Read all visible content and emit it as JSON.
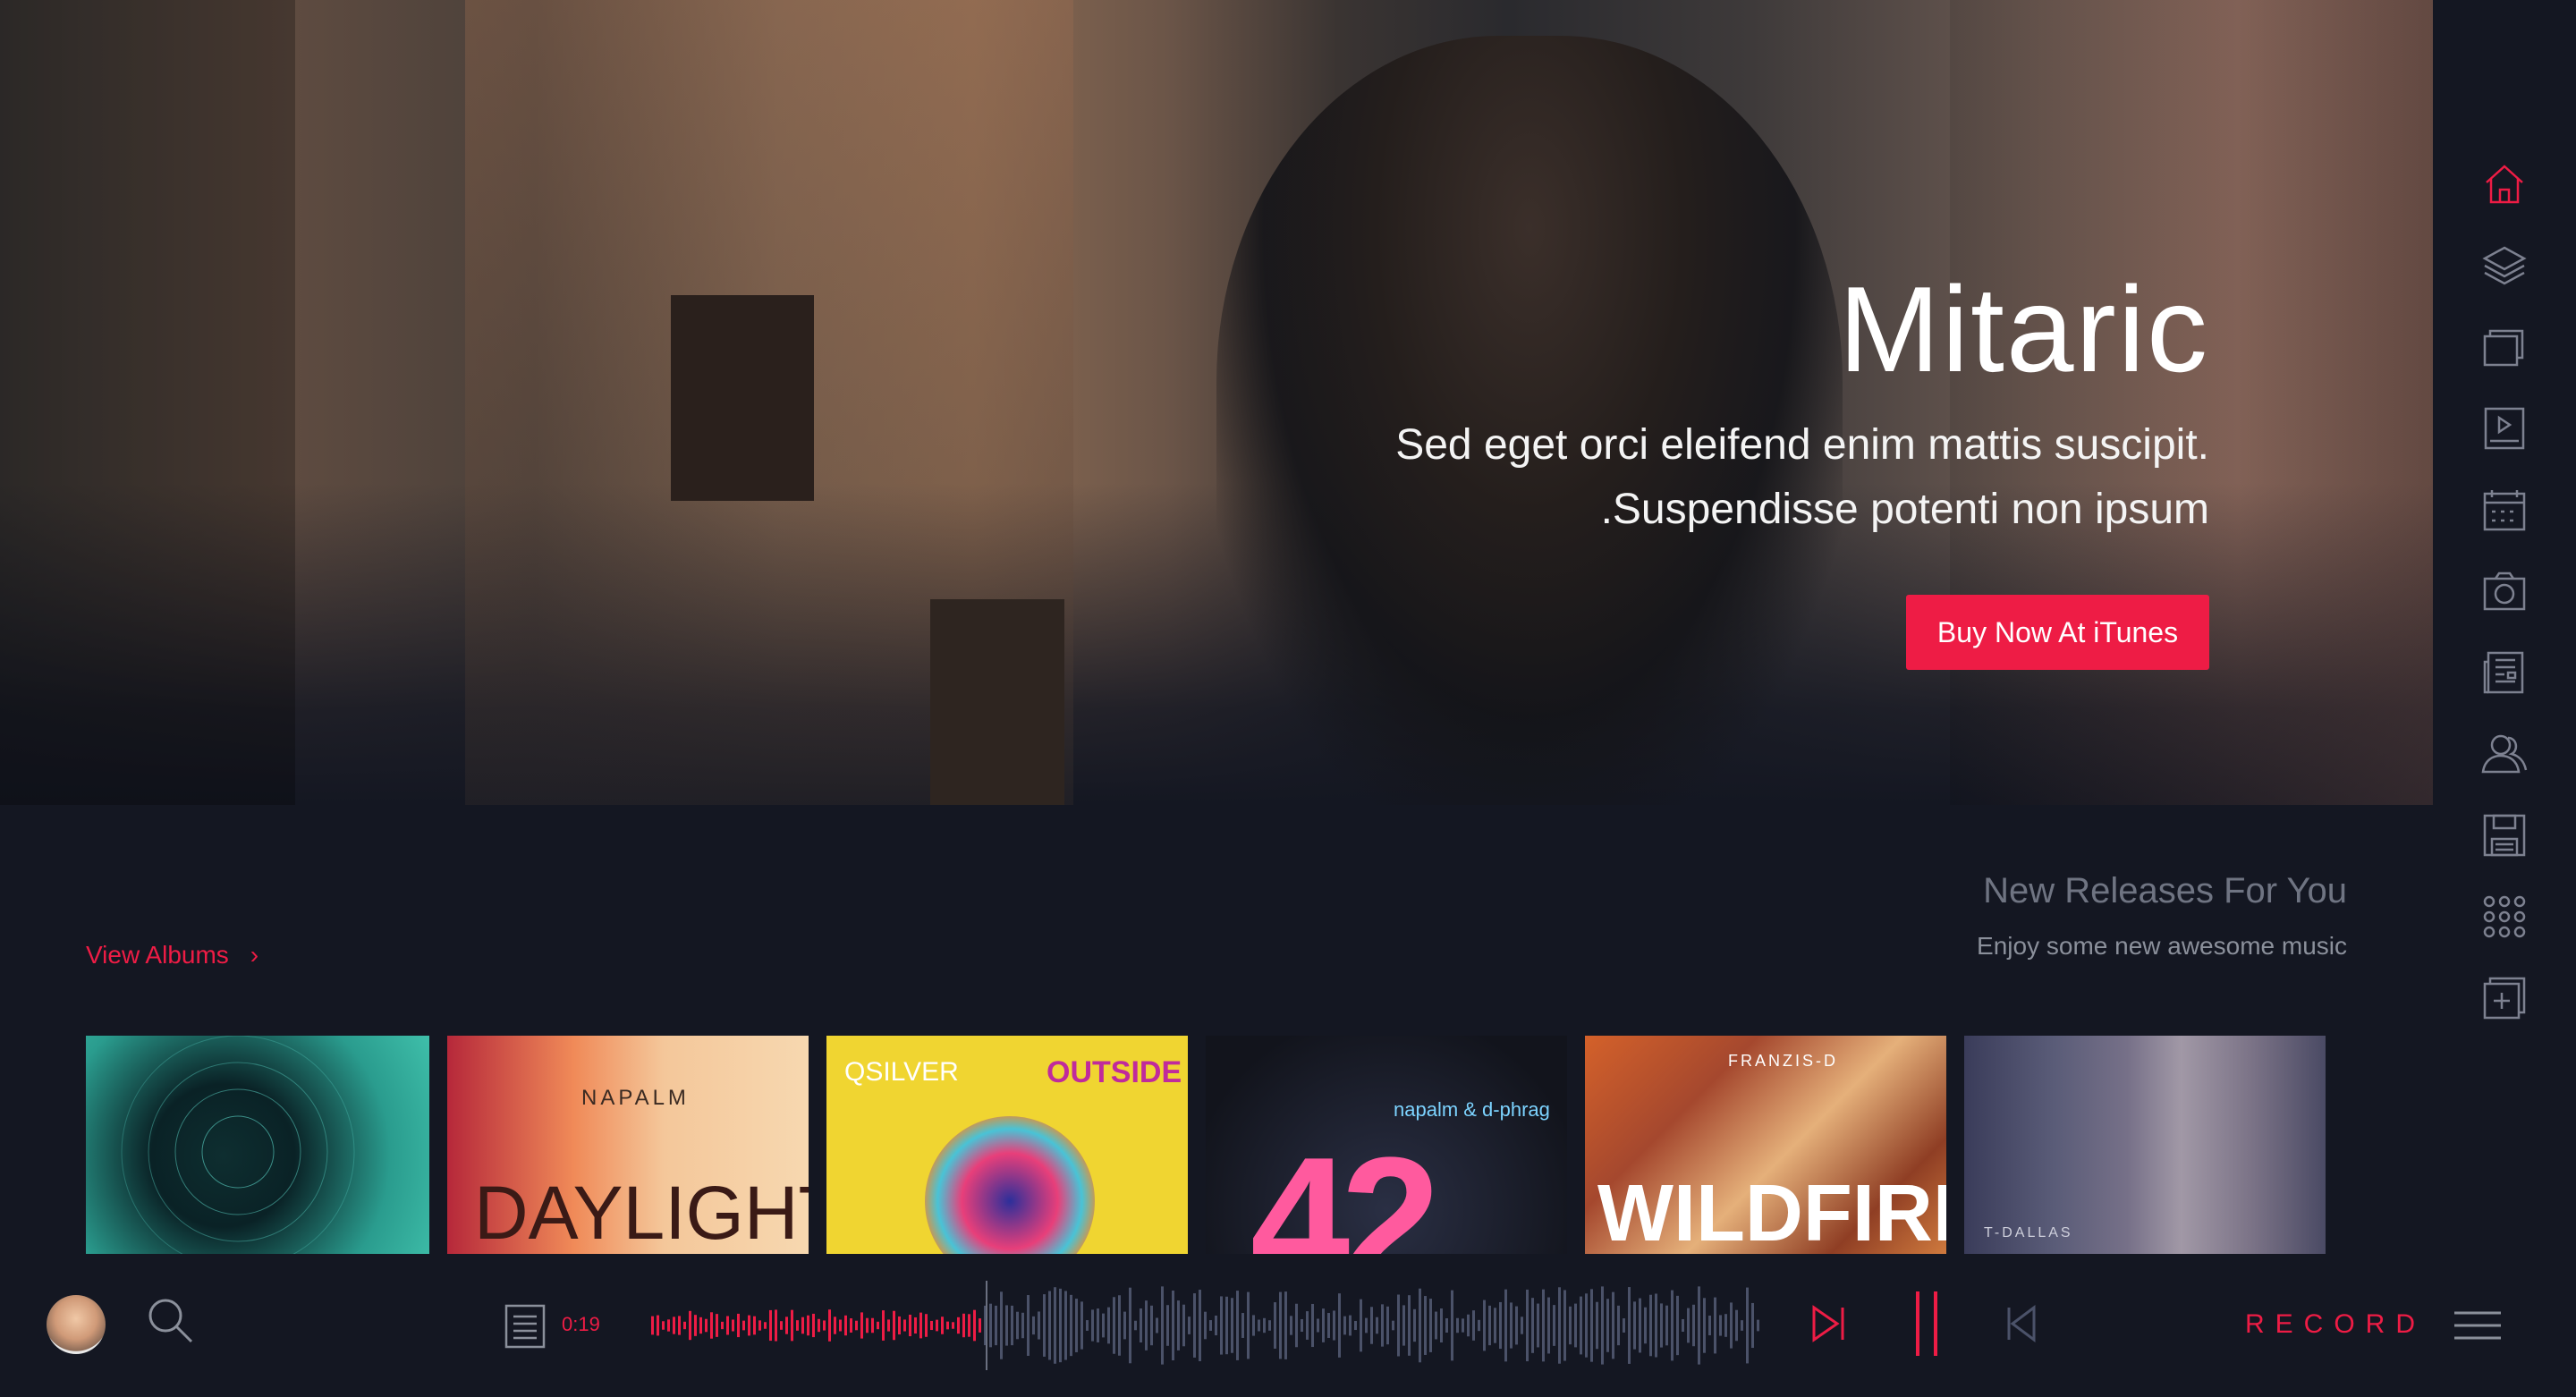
{
  "hero": {
    "title": "Mitaric",
    "subtitle_line1": "Sed eget orci eleifend enim mattis suscipit.",
    "subtitle_line2": ".Suspendisse potenti non ipsum",
    "cta_label": "Buy Now At iTunes"
  },
  "sidebar": {
    "items": [
      {
        "icon": "home-icon",
        "active": true
      },
      {
        "icon": "layers-icon",
        "active": false
      },
      {
        "icon": "gallery-icon",
        "active": false
      },
      {
        "icon": "video-icon",
        "active": false
      },
      {
        "icon": "calendar-icon",
        "active": false
      },
      {
        "icon": "camera-icon",
        "active": false
      },
      {
        "icon": "news-icon",
        "active": false
      },
      {
        "icon": "users-icon",
        "active": false
      },
      {
        "icon": "save-icon",
        "active": false
      },
      {
        "icon": "apps-grid-icon",
        "active": false
      },
      {
        "icon": "add-icon",
        "active": false
      }
    ]
  },
  "releases": {
    "title": "New Releases For You",
    "subtitle": "Enjoy some new awesome music",
    "view_albums": "View Albums",
    "albums": [
      {
        "text": ""
      },
      {
        "text": "NAPALM",
        "text2": "DAYLIGHT"
      },
      {
        "text": "QSILVER",
        "text2": "OUTSIDE"
      },
      {
        "text": "napalm & d-phrag",
        "text2": "42"
      },
      {
        "text": "FRANZIS-D",
        "text2": "WILDFIRE"
      },
      {
        "text": "T-DALLAS"
      }
    ]
  },
  "player": {
    "time": "0:19",
    "record_label": "RECORD",
    "progress": 0.3
  },
  "colors": {
    "accent": "#ee1c45",
    "background": "#141722",
    "muted": "#4b5269"
  }
}
